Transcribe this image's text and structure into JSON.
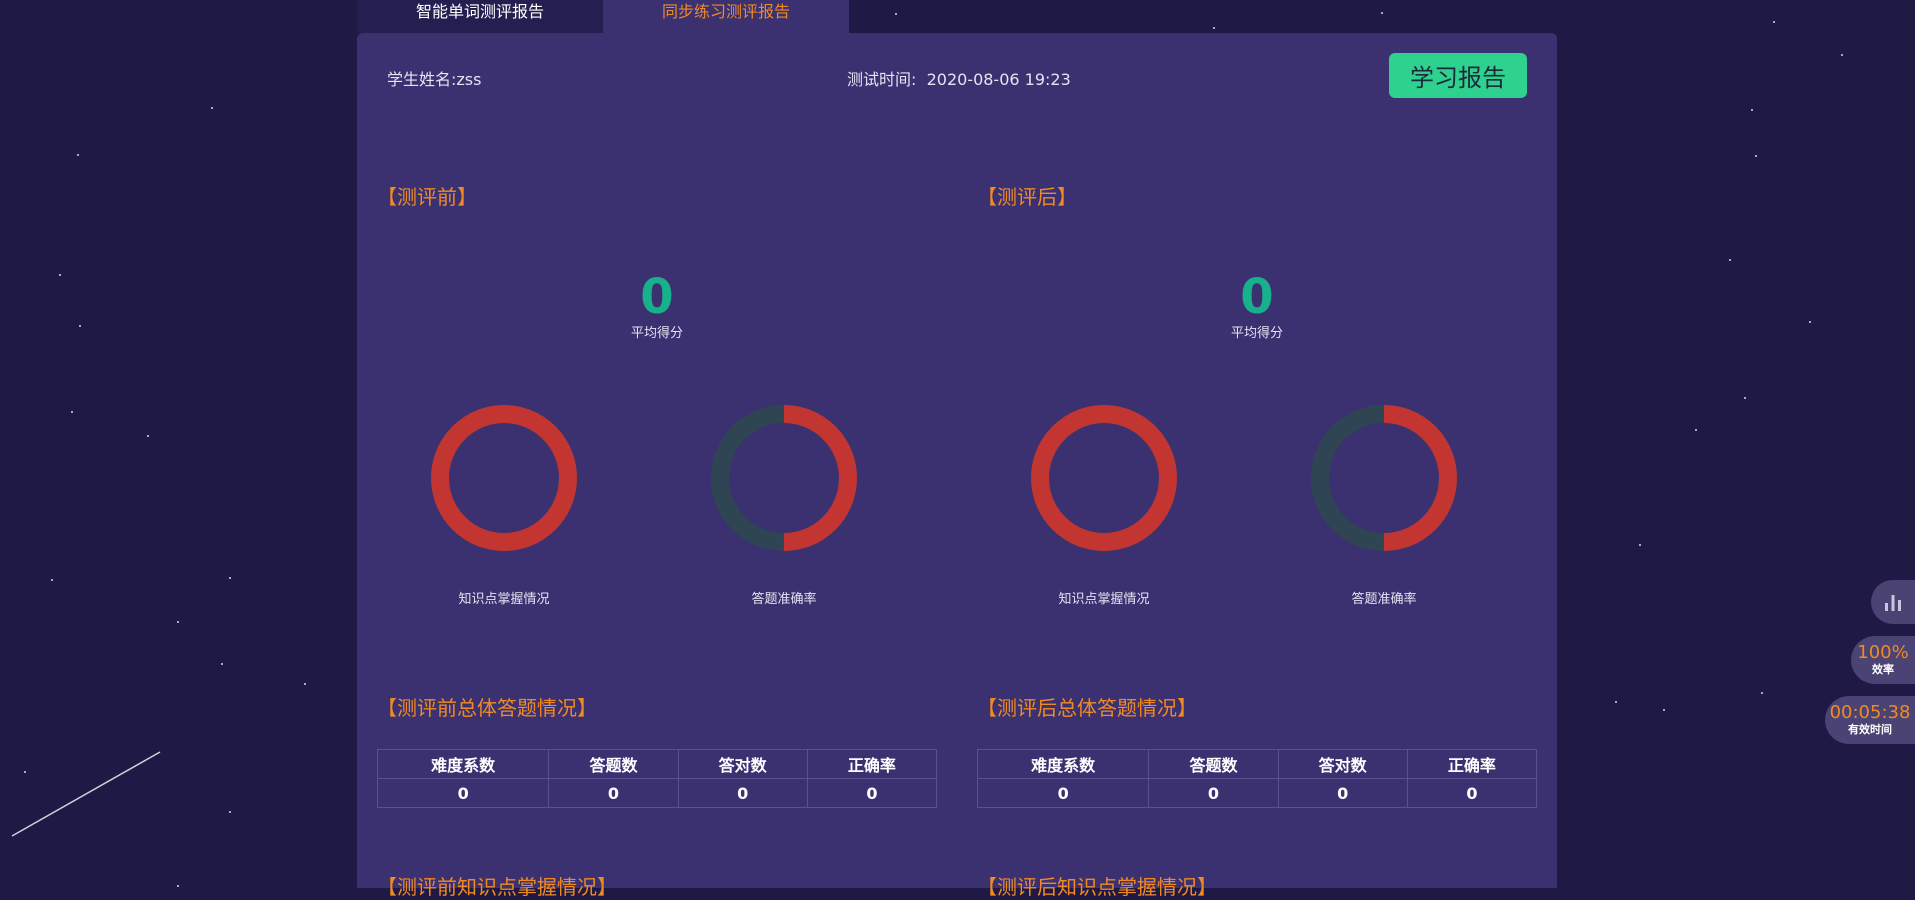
{
  "tabs": [
    {
      "label": "智能单词测评报告"
    },
    {
      "label": "同步练习测评报告"
    }
  ],
  "header": {
    "student_label": "学生姓名:",
    "student_name": "zss",
    "time_label": "测试时间:",
    "time_value": "2020-08-06 19:23",
    "report_button": "学习报告"
  },
  "before": {
    "title": "【测评前】",
    "score": "0",
    "score_label": "平均得分",
    "donut1_label": "知识点掌握情况",
    "donut2_label": "答题准确率",
    "summary_title": "【测评前总体答题情况】",
    "knowledge_title": "【测评前知识点掌握情况】"
  },
  "after": {
    "title": "【测评后】",
    "score": "0",
    "score_label": "平均得分",
    "donut1_label": "知识点掌握情况",
    "donut2_label": "答题准确率",
    "summary_title": "【测评后总体答题情况】",
    "knowledge_title": "【测评后知识点掌握情况】"
  },
  "table": {
    "headers": [
      "难度系数",
      "答题数",
      "答对数",
      "正确率"
    ],
    "before_row": [
      "0",
      "0",
      "0",
      "0"
    ],
    "after_row": [
      "0",
      "0",
      "0",
      "0"
    ]
  },
  "donut_values": {
    "knowledge_red_fraction": 1.0,
    "accuracy_red_fraction": 0.5
  },
  "side": {
    "chart_icon": "bar-chart-icon",
    "rate_value": "100%",
    "rate_label": "效率",
    "time_value": "00:05:38",
    "time_label": "有效时间"
  },
  "colors": {
    "background": "#1e1a45",
    "panel": "#3b3170",
    "accent_orange": "#f08a24",
    "score_green": "#19b08c",
    "button_green": "#2fd18f",
    "donut_red": "#c23531",
    "donut_dark": "#2f4554"
  }
}
